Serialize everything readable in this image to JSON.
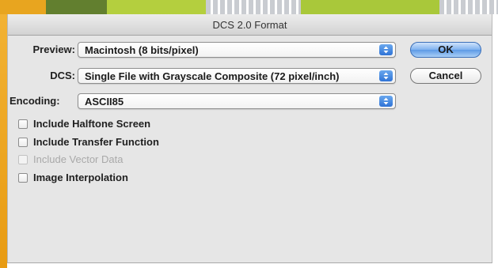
{
  "dialog": {
    "title": "DCS 2.0 Format"
  },
  "fields": {
    "preview": {
      "label": "Preview:",
      "value": "Macintosh  (8 bits/pixel)"
    },
    "dcs": {
      "label": "DCS:",
      "value": "Single File with Grayscale Composite (72 pixel/inch)"
    },
    "encoding": {
      "label": "Encoding:",
      "value": "ASCII85"
    }
  },
  "buttons": {
    "ok": "OK",
    "cancel": "Cancel"
  },
  "checkboxes": [
    {
      "label": "Include Halftone Screen",
      "checked": false,
      "enabled": true
    },
    {
      "label": "Include Transfer Function",
      "checked": false,
      "enabled": true
    },
    {
      "label": "Include Vector Data",
      "checked": false,
      "enabled": false
    },
    {
      "label": "Image Interpolation",
      "checked": false,
      "enabled": true
    }
  ],
  "colors": {
    "accent_orange": "#e89b12",
    "accent_green": "#a9c83a",
    "dark_green": "#5f7d2e",
    "button_blue": "#5d9ae6",
    "stepper_blue": "#2f73d6"
  }
}
